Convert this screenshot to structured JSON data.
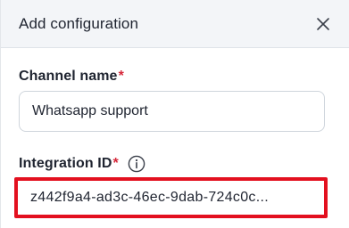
{
  "header": {
    "title": "Add configuration",
    "close_icon": "close-icon"
  },
  "form": {
    "channel_name": {
      "label": "Channel name",
      "required_mark": "*",
      "value": "Whatsapp support"
    },
    "integration_id": {
      "label": "Integration ID",
      "required_mark": "*",
      "info_icon": "info-icon",
      "value": "z442f9a4-ad3c-46ec-9dab-724c0c..."
    }
  },
  "colors": {
    "header_bg": "#f3f5f8",
    "required": "#d6283a",
    "highlight": "#e3101f",
    "text": "#1f2430"
  }
}
